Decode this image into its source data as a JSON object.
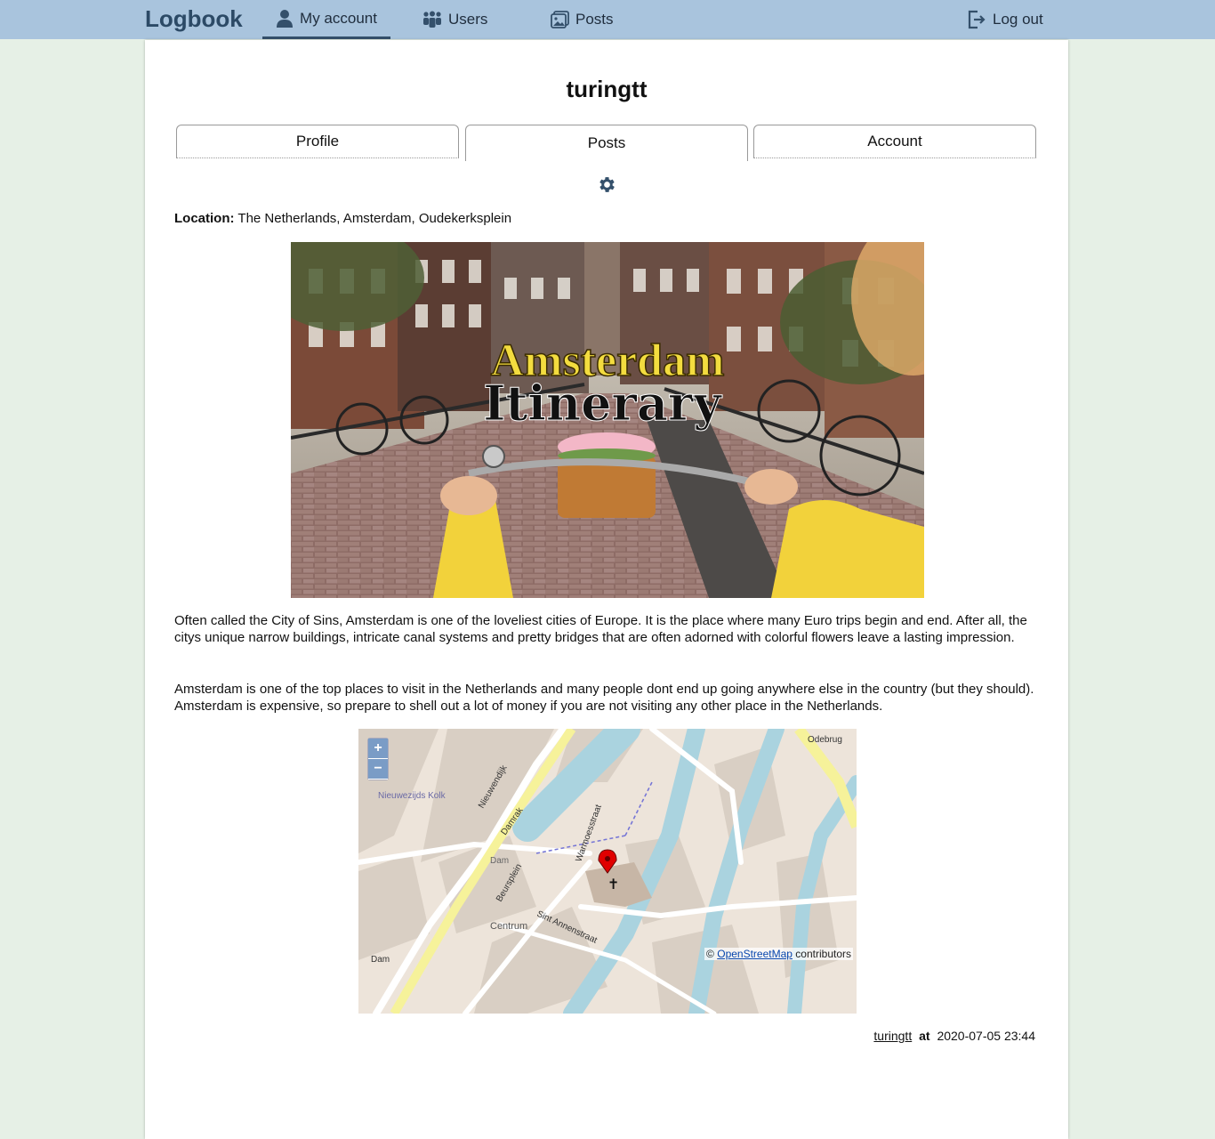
{
  "nav": {
    "brand": "Logbook",
    "items": [
      {
        "label": "My account",
        "icon": "person-icon",
        "active": true
      },
      {
        "label": "Users",
        "icon": "users-icon"
      },
      {
        "label": "Posts",
        "icon": "images-icon"
      }
    ],
    "logout": "Log out"
  },
  "profile": {
    "username": "turingtt",
    "tabs": [
      "Profile",
      "Posts",
      "Account"
    ],
    "active_tab": "Posts"
  },
  "post": {
    "location_label": "Location:",
    "location_value": "The Netherlands, Amsterdam, Oudekerksplein",
    "image_title_line1": "Amsterdam",
    "image_title_line2": "Itinerary",
    "paragraph1": "Often called the City of Sins, Amsterdam is one of the loveliest cities of Europe. It is the place where many Euro trips begin and end. After all, the citys unique narrow buildings, intricate canal systems and pretty bridges that are often adorned with colorful flowers leave a lasting impression.",
    "paragraph2": "Amsterdam is one of the top places to visit in the Netherlands and many people dont end up going anywhere else in the country (but they should). Amsterdam is expensive, so prepare to shell out a lot of money if you are not visiting any other place in the Netherlands.",
    "author": "turingtt",
    "at": "at",
    "timestamp": "2020-07-05 23:44"
  },
  "map": {
    "zoom_in": "+",
    "zoom_out": "−",
    "attribution_prefix": "©",
    "attribution_link": "OpenStreetMap",
    "attribution_suffix": "contributors",
    "labels": {
      "dam": "Dam",
      "dam_square": "Dam",
      "centrum": "Centrum",
      "damrak": "Damrak",
      "nieuwendijk": "Nieuwendijk",
      "warmoesstraat": "Warmoesstraat",
      "odebrug": "Odebrug",
      "nieuwezijds_kolk": "Nieuwezijds Kolk",
      "sint_annenstraat": "Sint Annenstraat",
      "beursplein": "Beursplein"
    }
  },
  "colors": {
    "navbar": "#a9c4dd",
    "brand": "#2c4a66",
    "page_bg": "#e6f0e6",
    "water": "#aad3df",
    "marker": "#e00000"
  }
}
